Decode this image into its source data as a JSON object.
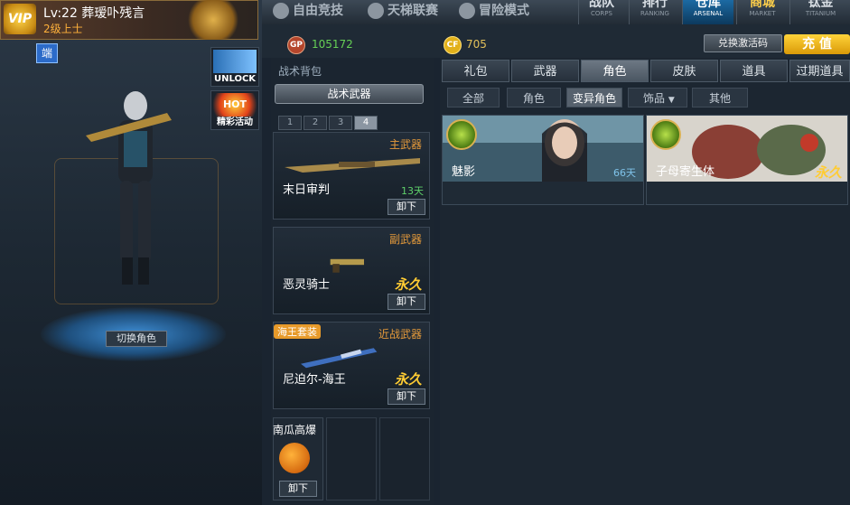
{
  "profile": {
    "vip_label": "VIP",
    "name": "Lv:22 葬瑷卟残言",
    "rank": "2级上士"
  },
  "client_badge": "端",
  "promos": {
    "unlock_label": "UNLOCK",
    "hot_art": "HOT",
    "hot_label": "精彩活动"
  },
  "switch_role_label": "切换角色",
  "modes": [
    "自由竞技",
    "天梯联赛",
    "冒险模式"
  ],
  "top_nav": [
    {
      "cn": "战队",
      "en": "CORPS"
    },
    {
      "cn": "排行",
      "en": "RANKING"
    },
    {
      "cn": "仓库",
      "en": "ARSENAL"
    },
    {
      "cn": "商城",
      "en": "MARKET"
    },
    {
      "cn": "钛金",
      "en": "TITANIUM"
    }
  ],
  "currency": {
    "gp_icon": "GP",
    "gp_value": "105172",
    "cp_icon": "CF",
    "cp_value": "705",
    "redeem_label": "兑换激活码",
    "recharge_label": "充 值"
  },
  "loadout": {
    "title": "战术背包",
    "tactical_label": "战术武器",
    "slots": [
      "1",
      "2",
      "3",
      "4"
    ],
    "primary": {
      "category": "主武器",
      "name": "末日审判",
      "duration": "13天",
      "unequip": "卸下"
    },
    "secondary": {
      "category": "副武器",
      "name": "恶灵骑士",
      "duration": "永久",
      "unequip": "卸下"
    },
    "melee": {
      "tag": "海王套装",
      "category": "近战武器",
      "name": "尼迫尔-海王",
      "duration": "永久",
      "unequip": "卸下"
    },
    "grenade": {
      "name": "南瓜高爆",
      "unequip": "卸下"
    }
  },
  "shop": {
    "categories": [
      "礼包",
      "武器",
      "角色",
      "皮肤",
      "道具",
      "过期道具"
    ],
    "subcategories": [
      "全部",
      "角色",
      "变异角色",
      "饰品",
      "其他"
    ],
    "items": [
      {
        "name": "魅影",
        "duration": "66天"
      },
      {
        "name": "子母寄生体",
        "duration": "永久"
      }
    ]
  },
  "colors": {
    "accent_blue": "#1c6aa3",
    "gold": "#ffcc33",
    "gp_green": "#66d155",
    "category_orange": "#e59a3a"
  }
}
